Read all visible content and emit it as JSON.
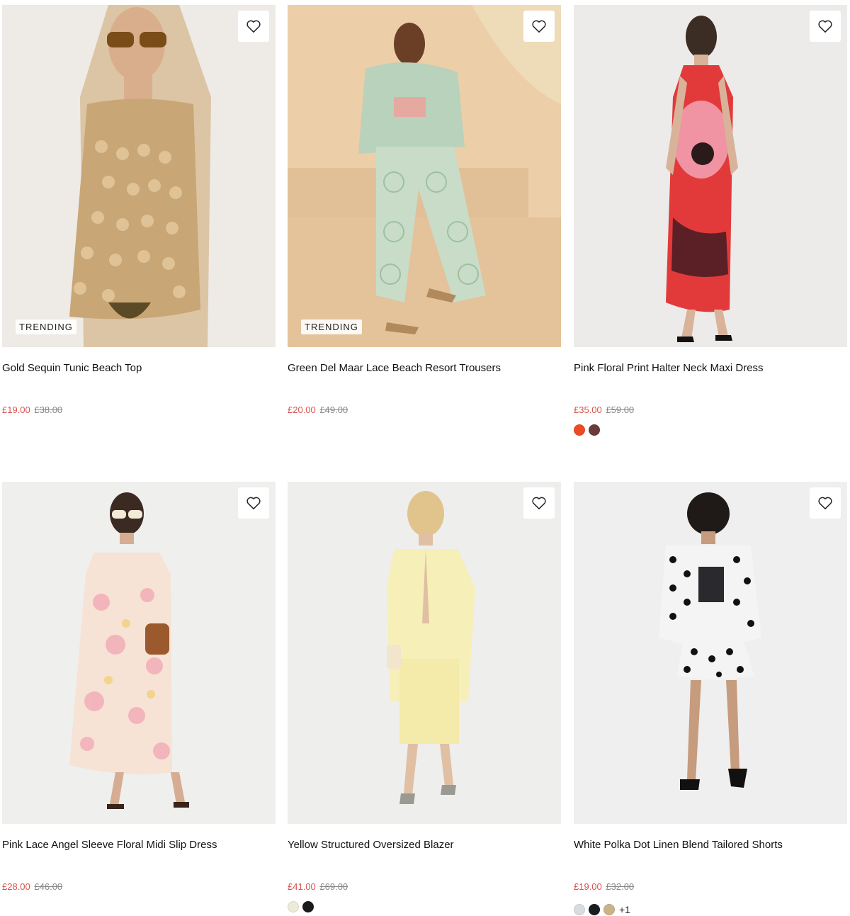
{
  "products": [
    {
      "title": "Gold Sequin Tunic Beach Top",
      "price_now": "£19.00",
      "price_was": "£38.00",
      "badge": "TRENDING",
      "swatches": [],
      "swatch_more": ""
    },
    {
      "title": "Green Del Maar Lace Beach Resort Trousers",
      "price_now": "£20.00",
      "price_was": "£49.00",
      "badge": "TRENDING",
      "swatches": [],
      "swatch_more": ""
    },
    {
      "title": "Pink Floral Print Halter Neck Maxi Dress",
      "price_now": "£35.00",
      "price_was": "£59.00",
      "badge": "",
      "swatches": [
        "#ee4a26",
        "#6b3b3b"
      ],
      "swatch_more": ""
    },
    {
      "title": "Pink Lace Angel Sleeve Floral Midi Slip Dress",
      "price_now": "£28.00",
      "price_was": "£46.00",
      "badge": "",
      "swatches": [],
      "swatch_more": ""
    },
    {
      "title": "Yellow Structured Oversized Blazer",
      "price_now": "£41.00",
      "price_was": "£69.00",
      "badge": "",
      "swatches": [
        "#ecebd7",
        "#1a1a1a"
      ],
      "swatch_more": ""
    },
    {
      "title": "White Polka Dot Linen Blend Tailored Shorts",
      "price_now": "£19.00",
      "price_was": "£32.00",
      "badge": "",
      "swatches": [
        "#d8dcdf",
        "#1c1c20",
        "#c9b48a"
      ],
      "swatch_more": "+1"
    }
  ],
  "icons": {
    "wishlist": "heart-outline-icon"
  },
  "colors": {
    "sale_price": "#d9534f",
    "was_price": "#888888"
  }
}
